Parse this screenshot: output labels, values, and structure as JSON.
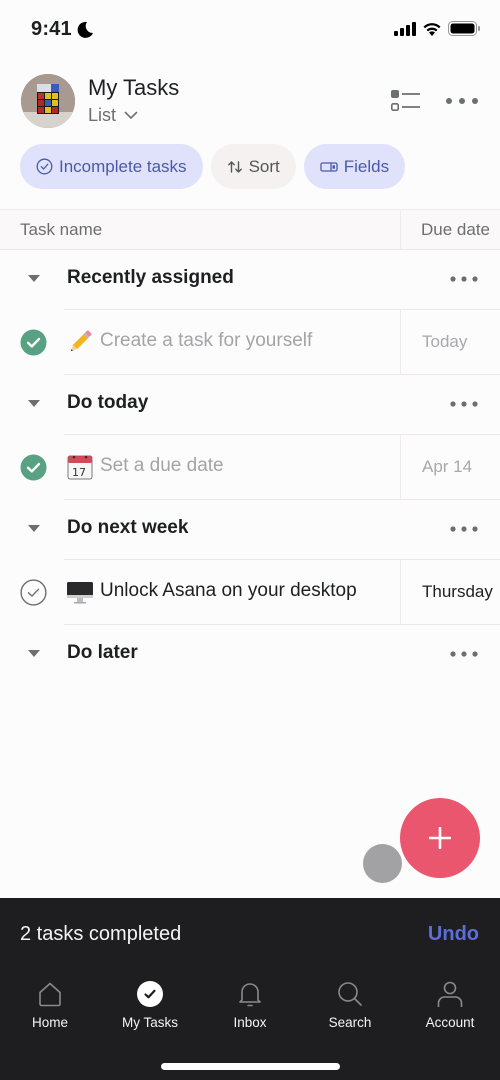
{
  "status_bar": {
    "time": "9:41",
    "focus_icon": "moon-icon",
    "signal_icon": "cellular-signal-icon",
    "wifi_icon": "wifi-icon",
    "battery_icon": "battery-icon"
  },
  "header": {
    "title": "My Tasks",
    "view_label": "List",
    "avatar_icon": "rubiks-cube-avatar",
    "layout_icon": "list-layout-icon",
    "more_icon": "more-horizontal-icon"
  },
  "chips": [
    {
      "label": "Incomplete tasks",
      "icon": "check-circle-icon"
    },
    {
      "label": "Sort",
      "icon": "sort-arrows-icon"
    },
    {
      "label": "Fields",
      "icon": "fields-icon"
    }
  ],
  "columns": {
    "task_name": "Task name",
    "due_date": "Due date"
  },
  "sections": [
    {
      "title": "Recently assigned",
      "tasks": [
        {
          "emoji": "✏️",
          "name": "Create a task for yourself",
          "due": "Today",
          "completed": true
        }
      ]
    },
    {
      "title": "Do today",
      "tasks": [
        {
          "emoji": "📆",
          "name": "Set a due date",
          "due": "Apr 14",
          "completed": true
        }
      ]
    },
    {
      "title": "Do next week",
      "tasks": [
        {
          "emoji": "🖥️",
          "name": "Unlock Asana on your desktop",
          "due": "Thursday",
          "completed": false
        }
      ]
    },
    {
      "title": "Do later",
      "tasks": []
    }
  ],
  "fab": {
    "icon": "plus-icon"
  },
  "snackbar": {
    "message": "2 tasks completed",
    "action": "Undo"
  },
  "tabbar": [
    {
      "label": "Home",
      "icon": "home-icon",
      "active": false
    },
    {
      "label": "My Tasks",
      "icon": "check-circle-filled-icon",
      "active": true
    },
    {
      "label": "Inbox",
      "icon": "bell-icon",
      "active": false
    },
    {
      "label": "Search",
      "icon": "search-icon",
      "active": false
    },
    {
      "label": "Account",
      "icon": "person-icon",
      "active": false
    }
  ],
  "colors": {
    "accent_blue": "#4a5aa8",
    "chip_blue_bg": "#e0e2fb",
    "complete_green": "#58a182",
    "fab_coral": "#e9566e",
    "undo_blue": "#5b6ed9",
    "bottom_bar_bg": "#1e1d20"
  }
}
